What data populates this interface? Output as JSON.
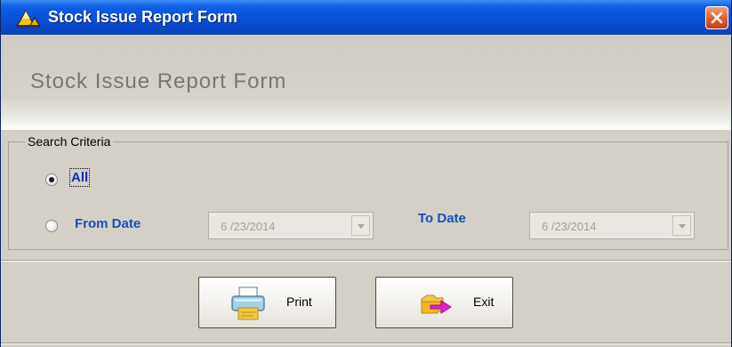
{
  "window": {
    "title": "Stock Issue Report Form"
  },
  "banner": {
    "title": "Stock Issue Report Form"
  },
  "search": {
    "legend": "Search Criteria",
    "option_all": "All",
    "option_from_date": "From Date",
    "from_date_value": "6 /23/2014",
    "to_date_label": "To Date",
    "to_date_value": "6 /23/2014"
  },
  "buttons": {
    "print": "Print",
    "exit": "Exit"
  },
  "icons": {
    "app": "app-icon",
    "close": "close-icon",
    "print": "printer-icon",
    "exit": "exit-icon",
    "dropdown": "chevron-down-icon"
  },
  "colors": {
    "title_bar": "#0a4fd8",
    "close_button": "#e05a2c",
    "label_blue": "#1a4fb5",
    "panel": "#d4d0c8"
  },
  "state": {
    "selected_option": "All"
  }
}
